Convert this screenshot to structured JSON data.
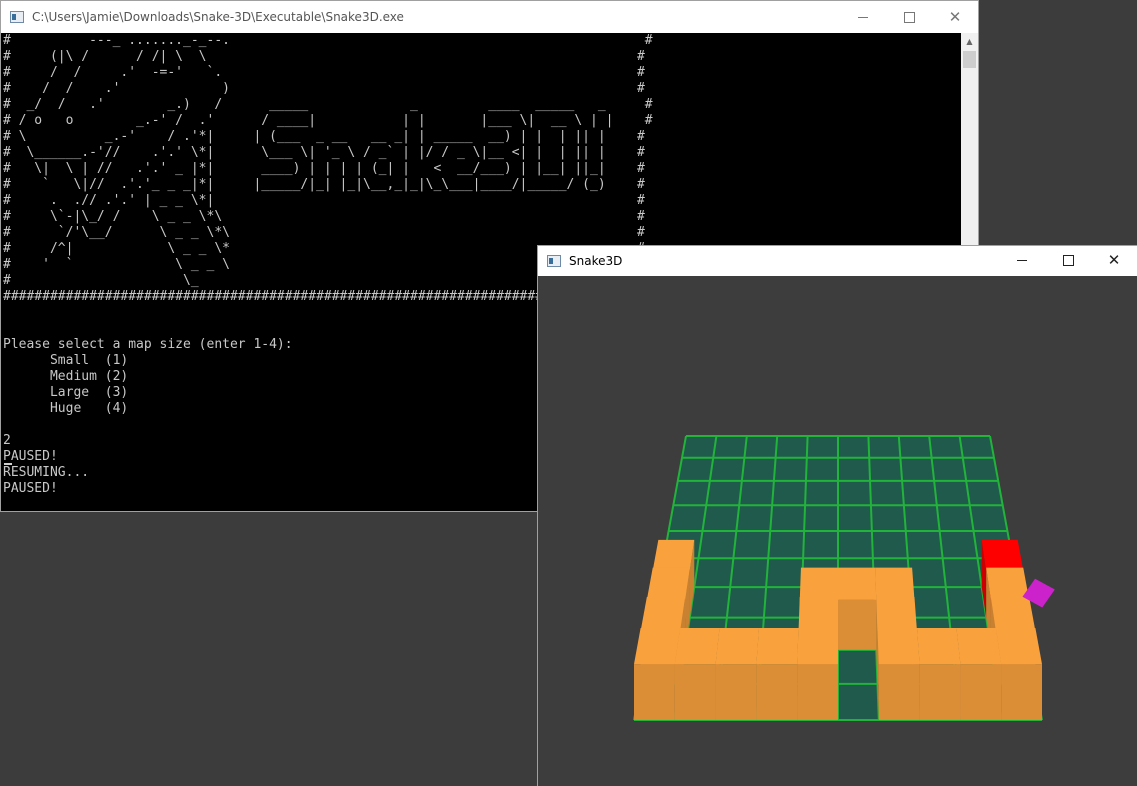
{
  "console": {
    "title": "C:\\Users\\Jamie\\Downloads\\Snake-3D\\Executable\\Snake3D.exe",
    "icon": "console-app-icon",
    "controls": [
      "minimize-icon",
      "maximize-icon",
      "close-icon"
    ],
    "output_lines": [
      "#          ---_ ......._-_--.                                                     #",
      "#     (|\\ /      / /| \\  \\                                                       #",
      "#     /  /     .'  -=-'   `.                                                     #",
      "#    /  /    .'             )                                                    #",
      "#  _/  /   .'        _.)   /      _____             _         ____  _____   _     #",
      "# / o   o        _.-' /  .'      / ____|           | |       |___ \\|  __ \\ | |    #",
      "# \\          _.-'    / .'*|     | (___  _ __   __ _| | _____  __) | |  | || |    #",
      "#  \\______.-'//    .'.' \\*|      \\___ \\| '_ \\ / _` | |/ / _ \\|__ <| |  | || |    #",
      "#   \\|  \\ | //   .'.' _ |*|      ____) | | | | (_| |   <  __/___) | |__| ||_|    #",
      "#    `   \\|//  .'.'_ _ _|*|     |_____/|_| |_|\\__,_|_|\\_\\___|____/|_____/ (_)    #",
      "#     .  .// .'.' | _ _ \\*|                                                      #",
      "#     \\`-|\\_/ /    \\ _ _ \\*\\                                                     #",
      "#      `/'\\__/      \\ _ _ \\*\\                                                    #",
      "#     /^|            \\ _ _ \\*                                                    #",
      "#    '  `             \\ _ _ \\                                                    #",
      "#                      \\_                                                        #",
      "##################################################################################",
      "",
      "",
      "Please select a map size (enter 1-4):",
      "      Small  (1)",
      "      Medium (2)",
      "      Large  (3)",
      "      Huge   (4)",
      "",
      "2",
      "PAUSED!",
      "RESUMING...",
      "PAUSED!"
    ]
  },
  "game": {
    "title": "Snake3D",
    "icon": "game-app-icon",
    "controls": [
      "minimize-icon",
      "maximize-icon",
      "close-icon"
    ],
    "colors": {
      "background": "#3d3d3d",
      "board": "#1f5a4c",
      "grid": "#22b33a",
      "snake_body": "#f9a13d",
      "snake_head": "#ff0000",
      "food": "#cc22cc"
    },
    "board_cells": 10,
    "snake_cells": [
      [
        9,
        7
      ],
      [
        9,
        8
      ],
      [
        9,
        9
      ],
      [
        8,
        9
      ],
      [
        7,
        9
      ],
      [
        6,
        9
      ],
      [
        6,
        8
      ],
      [
        6,
        7
      ],
      [
        5,
        7
      ],
      [
        4,
        7
      ],
      [
        4,
        8
      ],
      [
        4,
        9
      ],
      [
        3,
        9
      ],
      [
        2,
        9
      ],
      [
        1,
        9
      ],
      [
        0,
        9
      ],
      [
        0,
        8
      ],
      [
        0,
        7
      ],
      [
        0,
        6
      ]
    ],
    "snake_head_cell": [
      9,
      6
    ],
    "food_cell": [
      10,
      6
    ]
  }
}
